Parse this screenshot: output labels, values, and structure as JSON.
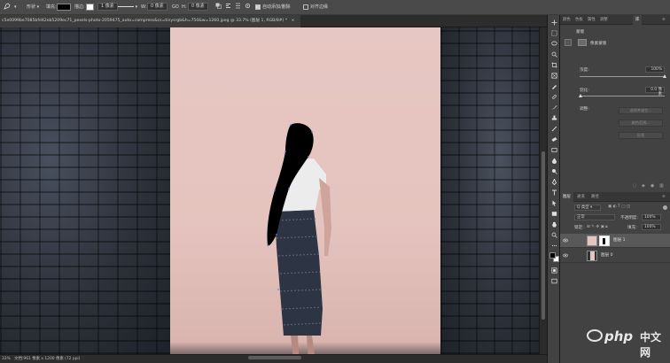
{
  "options_bar": {
    "mode_label": "形状",
    "fill_label": "填充:",
    "stroke_label": "描边:",
    "stroke_size": "1 像素",
    "width_label": "W:",
    "width_value": "0 像素",
    "link_label": "GO",
    "height_label": "H:",
    "height_value": "0 像素",
    "auto_add_delete_label": "自动添加/删除",
    "align_edges_label": "对齐边缘",
    "fill_color": "#000000",
    "stroke_color": "#ffffff"
  },
  "document_tab": {
    "title": "c5e0099be7085bfd42eb5209ec71_pexels-photo-2059475_auto=compress&cs=tinysrgb&h=750&w=1260.jpeg @ 33.7% (图层 1, RGB/8#) *",
    "close_icon": "×"
  },
  "status_bar": {
    "zoom": "33%",
    "doc_info": "文档:961 像素 x 1200 像素 (72 ppi)"
  },
  "panels": {
    "top_tabs": [
      "颜色",
      "色板",
      "属性",
      "调整",
      "库"
    ],
    "top_active": 2,
    "properties": {
      "section_label": "蒙版",
      "pixel_mask_label": "像素蒙版",
      "density_label": "浓度:",
      "density_value": "100%",
      "feather_label": "羽化:",
      "feather_value": "0.0 像素",
      "refine_label": "调整:",
      "select_mask_btn": "选择并遮住...",
      "color_range_btn": "颜色范围...",
      "invert_btn": "反相"
    },
    "layer_tabs": [
      "图层",
      "通道",
      "路径"
    ],
    "layer_active": 0,
    "kind_filter": "Q 类型",
    "blend_mode": "正常",
    "opacity_label": "不透明度:",
    "opacity_value": "100%",
    "lock_label": "锁定:",
    "fill_label": "填充:",
    "fill_value": "100%",
    "layers": [
      {
        "name": "图层 1",
        "selected": true
      },
      {
        "name": "图层 0",
        "selected": false
      }
    ]
  },
  "watermark": {
    "text": "php",
    "cn": "中文网"
  },
  "colors": {
    "canvas_bg": "#e6c4bf",
    "panel_bg": "#424242",
    "selected_layer": "#595959"
  }
}
